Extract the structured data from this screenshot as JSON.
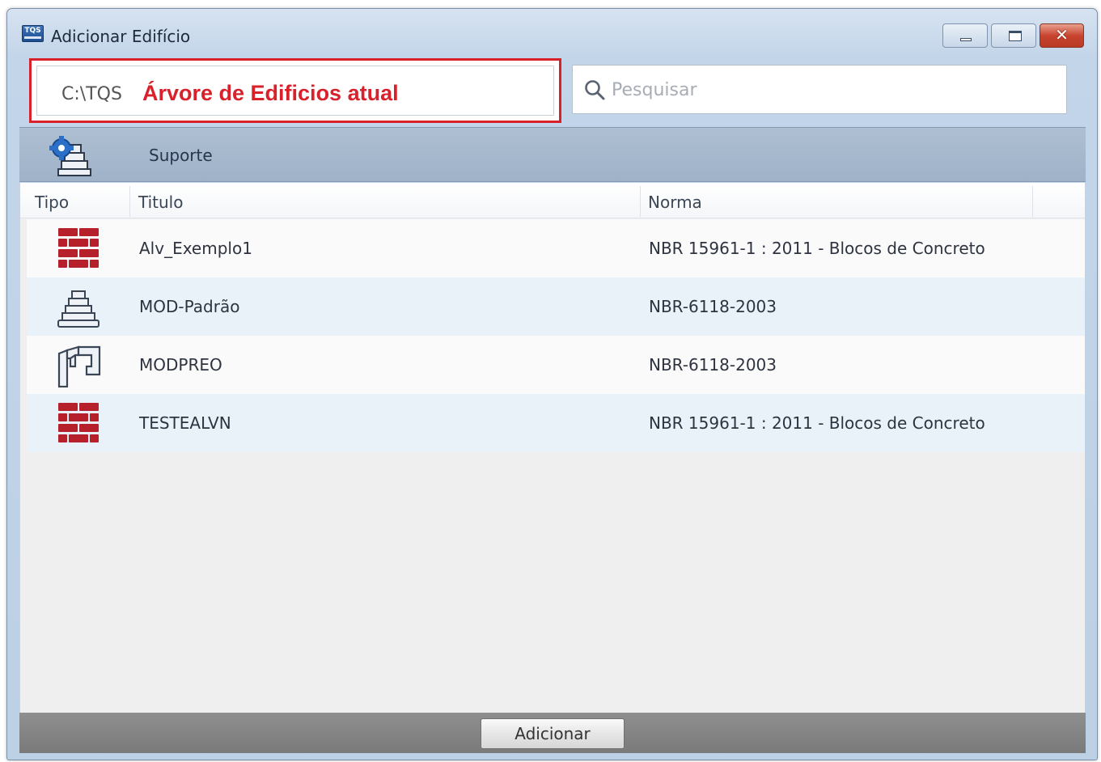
{
  "window": {
    "title": "Adicionar Edifício",
    "app_icon_text": "TQS"
  },
  "path": {
    "value": "C:\\TQS",
    "annotation": "Árvore de Edificios atual"
  },
  "search": {
    "placeholder": "Pesquisar"
  },
  "category_bar": {
    "items": [
      {
        "label": "Suporte",
        "icon": "support-building-icon"
      }
    ]
  },
  "table": {
    "columns": [
      "Tipo",
      "Titulo",
      "Norma"
    ],
    "rows": [
      {
        "icon": "masonry-brick-icon",
        "titulo": "Alv_Exemplo1",
        "norma": "NBR 15961-1 : 2011 - Blocos de Concreto"
      },
      {
        "icon": "building-stack-icon",
        "titulo": "MOD-Padrão",
        "norma": "NBR-6118-2003"
      },
      {
        "icon": "precast-frame-icon",
        "titulo": "MODPREO",
        "norma": "NBR-6118-2003"
      },
      {
        "icon": "masonry-brick-icon",
        "titulo": "TESTEALVN",
        "norma": "NBR 15961-1 : 2011 - Blocos de Concreto"
      }
    ]
  },
  "footer": {
    "add_label": "Adicionar"
  },
  "colors": {
    "highlight_red": "#d9212b",
    "brick_red": "#b5202b",
    "catbar": "#a7b9cd"
  }
}
